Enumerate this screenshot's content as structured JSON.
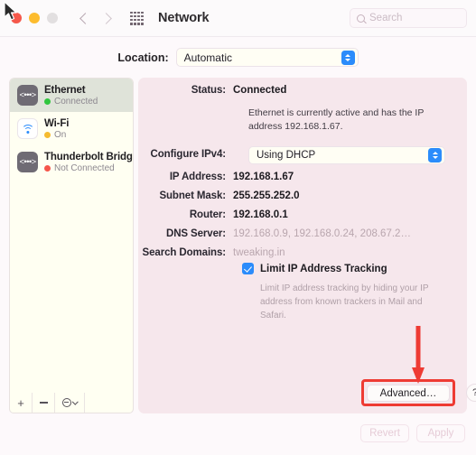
{
  "window": {
    "title": "Network",
    "traffic_lights": [
      "close",
      "minimize",
      "maximize"
    ]
  },
  "toolbar": {
    "back_icon": "chevron-left-icon",
    "forward_icon": "chevron-right-icon",
    "grid_icon": "grid-apps-icon",
    "search": {
      "placeholder": "Search",
      "value": "",
      "icon": "search-icon"
    }
  },
  "location": {
    "label": "Location:",
    "value": "Automatic"
  },
  "sidebar": {
    "items": [
      {
        "name": "Ethernet",
        "status": "Connected",
        "status_color": "#31c63f",
        "icon": "ethernet-icon",
        "selected": true
      },
      {
        "name": "Wi-Fi",
        "status": "On",
        "status_color": "#f5bb2f",
        "icon": "wifi-icon",
        "selected": false
      },
      {
        "name": "Thunderbolt Bridge",
        "status": "Not Connected",
        "status_color": "#f5554a",
        "icon": "ethernet-icon",
        "selected": false
      }
    ],
    "footer": {
      "add_label": "+",
      "remove_icon": "minus-icon",
      "actions_icon": "circle-minus-menu-icon"
    }
  },
  "detail": {
    "status_label": "Status:",
    "status_value": "Connected",
    "status_description": "Ethernet is currently active and has the IP address 192.168.1.67.",
    "configure_ipv4_label": "Configure IPv4:",
    "configure_ipv4_value": "Using DHCP",
    "fields": [
      {
        "label": "IP Address:",
        "value": "192.168.1.67",
        "muted": false
      },
      {
        "label": "Subnet Mask:",
        "value": "255.255.252.0",
        "muted": false
      },
      {
        "label": "Router:",
        "value": "192.168.0.1",
        "muted": false
      },
      {
        "label": "DNS Server:",
        "value": "192.168.0.9, 192.168.0.24, 208.67.2…",
        "muted": true
      },
      {
        "label": "Search Domains:",
        "value": "tweaking.in",
        "muted": true
      }
    ],
    "limit_tracking": {
      "label": "Limit IP Address Tracking",
      "checked": true,
      "help": "Limit IP address tracking by hiding your IP address from known trackers in Mail and Safari."
    },
    "advanced_label": "Advanced…",
    "help_label": "?"
  },
  "annotation": {
    "arrow_color": "#ee3b33",
    "highlight_color": "#ee3b33",
    "target": "advanced-button"
  },
  "footer": {
    "revert_label": "Revert",
    "apply_label": "Apply"
  }
}
